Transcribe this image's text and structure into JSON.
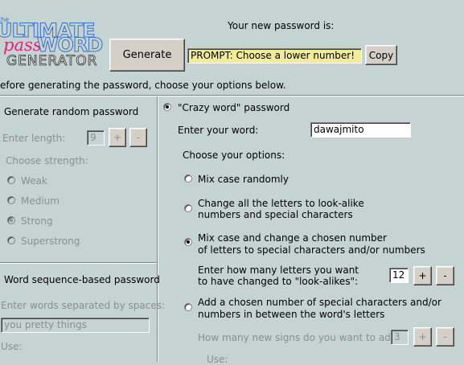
{
  "logo": {
    "the": "the",
    "ultimate": "ULTIMATE",
    "pass": "pass",
    "word": "WORD",
    "generator": "GENERATOR"
  },
  "header": {
    "password_caption": "Your new password is:",
    "generate_label": "Generate",
    "password_value": "PROMPT: Choose a lower number!",
    "copy_label": "Copy",
    "instructions": "efore generating the password, choose your options below."
  },
  "left": {
    "random_title": "Generate random password",
    "length_label": "Enter length:",
    "length_value": "9",
    "plus": "+",
    "minus": "-",
    "strength_label": "Choose strength:",
    "strengths": [
      "Weak",
      "Medium",
      "Strong",
      "Superstrong"
    ],
    "strength_selected": "Strong",
    "sequence_title": "Word sequence-based password",
    "sequence_hint": "Enter words separated by spaces:",
    "sequence_value": "you pretty things",
    "use_label": "Use:"
  },
  "right": {
    "crazy_title": "\"Crazy word\" password",
    "enter_word_label": "Enter your word:",
    "word_value": "dawajmito",
    "options_label": "Choose your options:",
    "option_mix": "Mix case randomly",
    "option_change_line1": "Change all the letters to look-alike",
    "option_change_line2": "numbers and special characters",
    "option_mixchosen_line1": "Mix case and change a chosen number",
    "option_mixchosen_line2": "of letters to special characters and/or numbers",
    "howmany_line1": "Enter how many letters you want",
    "howmany_line2": "to have changed to \"look-alikes\":",
    "howmany_value": "12",
    "option_add_line1": "Add a chosen number of special characters and/or",
    "option_add_line2": "numbers in between the word's letters",
    "signs_label": "How many new signs do you want to add?",
    "signs_value": "3",
    "use_label": "Use:",
    "plus": "+",
    "minus": "-"
  },
  "colors": {
    "background": "#c5d3d3",
    "password_field": "#f2ec9a",
    "logo_blue": "#3b6fc4",
    "logo_pink": "#e0247a"
  }
}
